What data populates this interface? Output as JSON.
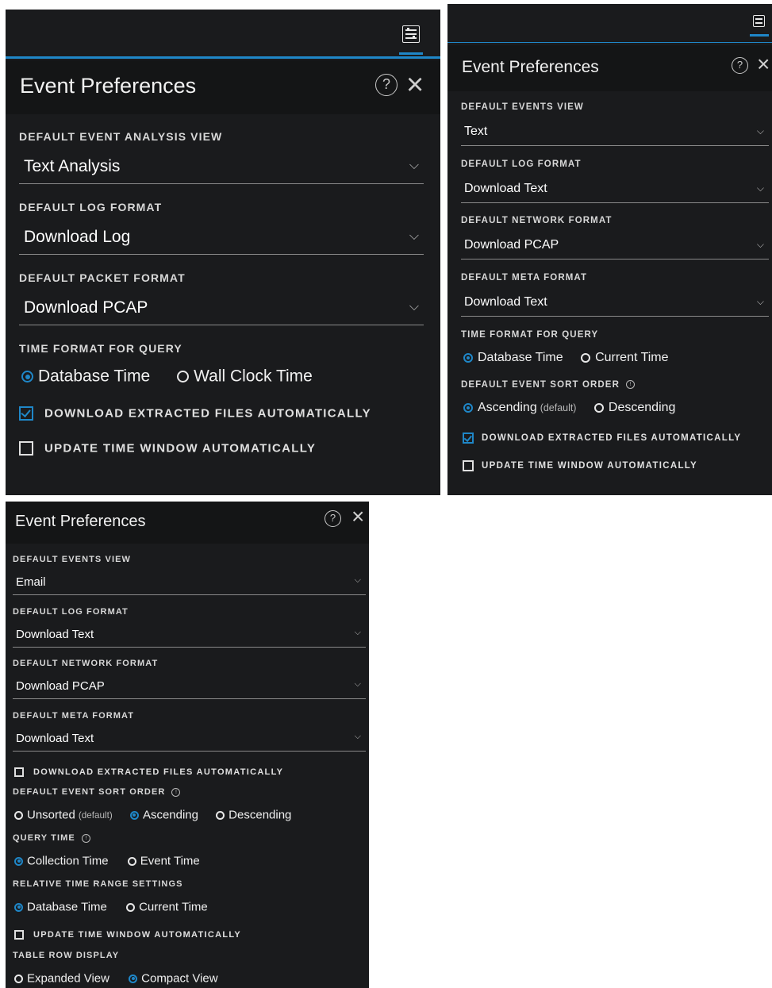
{
  "panel_a": {
    "title": "Event Preferences",
    "help_icon": "?",
    "close_icon": "×",
    "fields": [
      {
        "label": "DEFAULT EVENT ANALYSIS VIEW",
        "value": "Text Analysis"
      },
      {
        "label": "DEFAULT LOG FORMAT",
        "value": "Download Log"
      },
      {
        "label": "DEFAULT PACKET FORMAT",
        "value": "Download PCAP"
      }
    ],
    "time_format": {
      "label": "TIME FORMAT FOR QUERY",
      "options": [
        "Database Time",
        "Wall Clock Time"
      ],
      "selected": 0
    },
    "checks": [
      {
        "label": "DOWNLOAD EXTRACTED FILES AUTOMATICALLY",
        "checked": true
      },
      {
        "label": "UPDATE TIME WINDOW AUTOMATICALLY",
        "checked": false
      }
    ]
  },
  "panel_b": {
    "title": "Event Preferences",
    "help_icon": "?",
    "close_icon": "×",
    "fields": [
      {
        "label": "DEFAULT EVENTS VIEW",
        "value": "Text"
      },
      {
        "label": "DEFAULT LOG FORMAT",
        "value": "Download Text"
      },
      {
        "label": "DEFAULT NETWORK FORMAT",
        "value": "Download PCAP"
      },
      {
        "label": "DEFAULT META FORMAT",
        "value": "Download Text"
      }
    ],
    "time_format": {
      "label": "TIME FORMAT FOR QUERY",
      "options": [
        "Database Time",
        "Current Time"
      ],
      "selected": 0
    },
    "sort_order": {
      "label": "DEFAULT EVENT SORT ORDER",
      "info_icon": "!",
      "options": [
        "Ascending",
        "Descending"
      ],
      "default_note": "(default)",
      "selected": 0
    },
    "checks": [
      {
        "label": "DOWNLOAD EXTRACTED FILES AUTOMATICALLY",
        "checked": true
      },
      {
        "label": "UPDATE TIME WINDOW AUTOMATICALLY",
        "checked": false
      }
    ]
  },
  "panel_c": {
    "title": "Event Preferences",
    "help_icon": "?",
    "close_icon": "×",
    "fields": [
      {
        "label": "DEFAULT EVENTS VIEW",
        "value": "Email"
      },
      {
        "label": "DEFAULT LOG FORMAT",
        "value": "Download Text"
      },
      {
        "label": "DEFAULT NETWORK FORMAT",
        "value": "Download PCAP"
      },
      {
        "label": "DEFAULT META FORMAT",
        "value": "Download Text"
      }
    ],
    "download_check": {
      "label": "DOWNLOAD EXTRACTED FILES AUTOMATICALLY",
      "checked": false
    },
    "sort_order": {
      "label": "DEFAULT EVENT SORT ORDER",
      "info_icon": "!",
      "options": [
        "Unsorted",
        "Ascending",
        "Descending"
      ],
      "default_note": "(default)",
      "selected": 1
    },
    "query_time": {
      "label": "QUERY TIME",
      "info_icon": "!",
      "options": [
        "Collection Time",
        "Event Time"
      ],
      "selected": 0
    },
    "relative_time": {
      "label": "RELATIVE TIME RANGE SETTINGS",
      "options": [
        "Database Time",
        "Current Time"
      ],
      "selected": 0
    },
    "update_check": {
      "label": "UPDATE TIME WINDOW AUTOMATICALLY",
      "checked": false
    },
    "row_display": {
      "label": "TABLE ROW DISPLAY",
      "options": [
        "Expanded View",
        "Compact View"
      ],
      "selected": 1
    }
  },
  "colors": {
    "accent": "#1f87c8",
    "panel_bg": "#1a1b1d",
    "header_bg": "#141516"
  },
  "icons": {
    "toolbar": "event-preferences-icon",
    "select": "chevron-down-icon"
  }
}
